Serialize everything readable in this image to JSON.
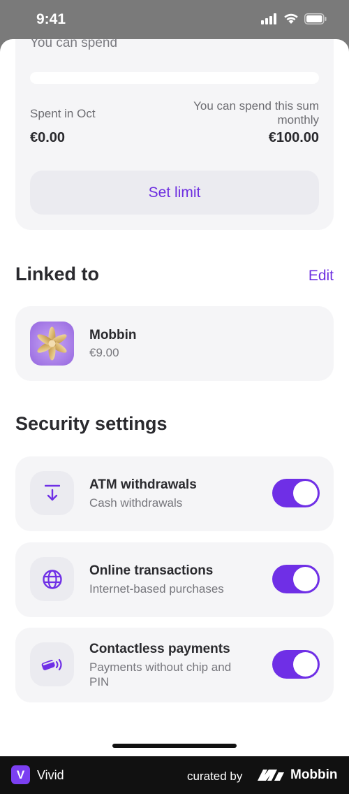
{
  "status_bar": {
    "time": "9:41"
  },
  "spending": {
    "title": "You can spend",
    "progress_fraction": 0,
    "spent_label": "Spent in Oct",
    "spent_value": "€0.00",
    "limit_label": "You can spend this sum monthly",
    "limit_value": "€100.00",
    "set_limit_label": "Set limit"
  },
  "linked": {
    "title": "Linked to",
    "edit_label": "Edit",
    "account": {
      "name": "Mobbin",
      "balance": "€9.00"
    }
  },
  "security": {
    "title": "Security settings",
    "items": [
      {
        "title": "ATM withdrawals",
        "subtitle": "Cash withdrawals",
        "icon": "atm-withdraw-icon",
        "enabled": true
      },
      {
        "title": "Online transactions",
        "subtitle": "Internet-based purchases",
        "icon": "globe-icon",
        "enabled": true
      },
      {
        "title": "Contactless payments",
        "subtitle": "Payments without chip and PIN",
        "icon": "contactless-card-icon",
        "enabled": true
      }
    ]
  },
  "footer": {
    "logo_letter": "V",
    "app_name": "Vivid",
    "curated_label": "curated by",
    "brand": "Mobbin"
  },
  "colors": {
    "accent": "#6f2fe6",
    "card_bg": "#f5f5f7",
    "text_primary": "#2a2a2e",
    "text_secondary": "#76767c"
  }
}
